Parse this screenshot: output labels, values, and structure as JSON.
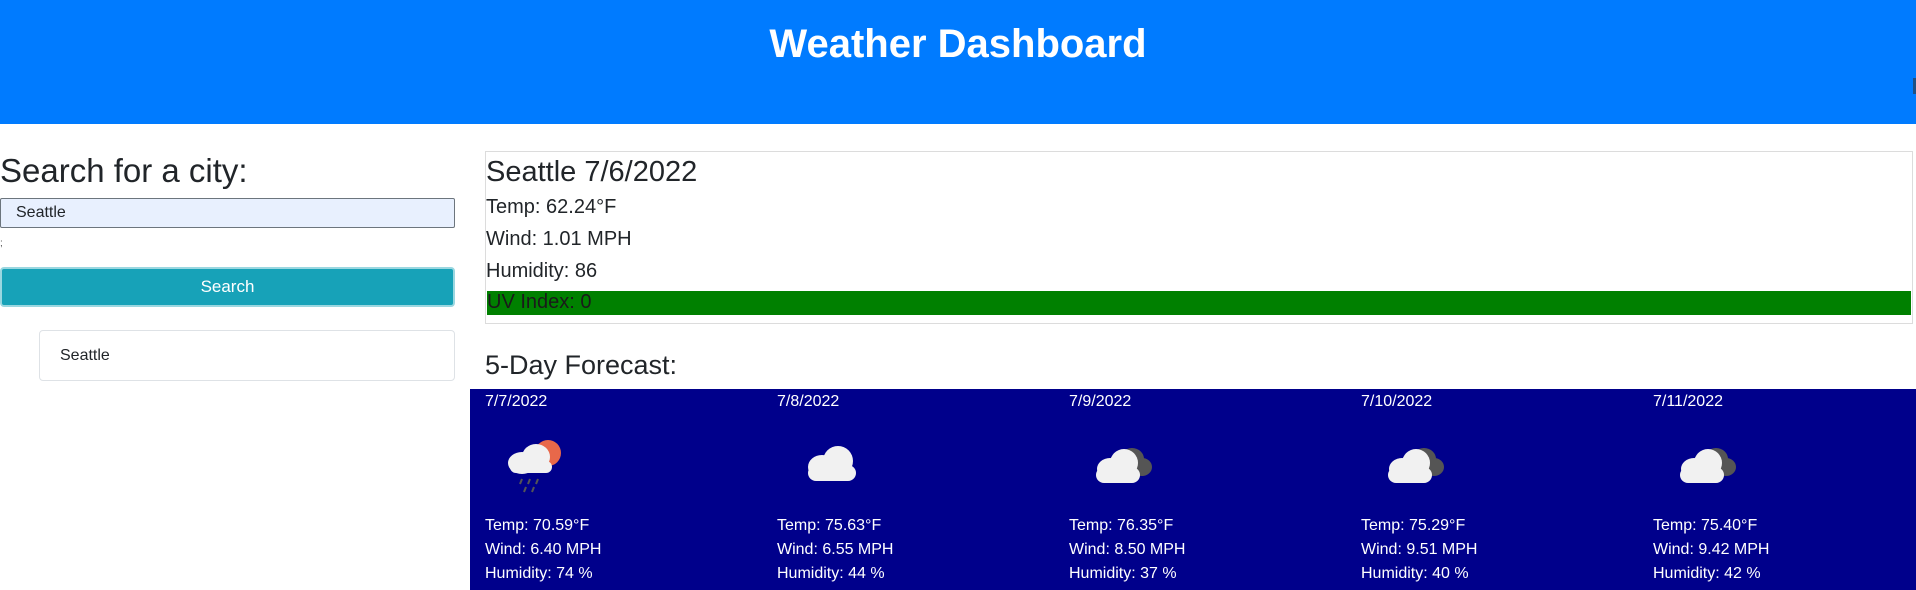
{
  "header": {
    "title": "Weather Dashboard"
  },
  "search": {
    "heading": "Search for a city:",
    "input_value": "Seattle",
    "button_label": "Search",
    "history": [
      "Seattle"
    ]
  },
  "current": {
    "city_date": "Seattle 7/6/2022",
    "temp": "Temp: 62.24°F",
    "wind": "Wind: 1.01 MPH",
    "humidity": "Humidity: 86",
    "uv": "UV Index: 0",
    "uv_color": "#008000"
  },
  "forecast": {
    "heading": "5-Day Forecast:",
    "panel_color": "#00008b",
    "days": [
      {
        "date": "7/7/2022",
        "icon": "rain-sun-cloud-icon",
        "temp": "Temp: 70.59°F",
        "wind": "Wind: 6.40 MPH",
        "humidity": "Humidity: 74 %"
      },
      {
        "date": "7/8/2022",
        "icon": "cloud-icon",
        "temp": "Temp: 75.63°F",
        "wind": "Wind: 6.55 MPH",
        "humidity": "Humidity: 44 %"
      },
      {
        "date": "7/9/2022",
        "icon": "broken-clouds-icon",
        "temp": "Temp: 76.35°F",
        "wind": "Wind: 8.50 MPH",
        "humidity": "Humidity: 37 %"
      },
      {
        "date": "7/10/2022",
        "icon": "broken-clouds-icon",
        "temp": "Temp: 75.29°F",
        "wind": "Wind: 9.51 MPH",
        "humidity": "Humidity: 40 %"
      },
      {
        "date": "7/11/2022",
        "icon": "broken-clouds-icon",
        "temp": "Temp: 75.40°F",
        "wind": "Wind: 9.42 MPH",
        "humidity": "Humidity: 42 %"
      }
    ]
  }
}
